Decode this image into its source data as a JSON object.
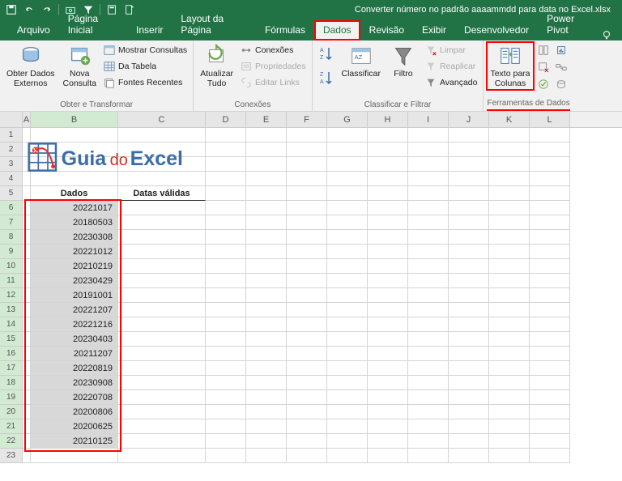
{
  "titlebar": {
    "filename": "Converter número no padrão aaaammdd para data no Excel.xlsx"
  },
  "tabs": {
    "file": "Arquivo",
    "home": "Página Inicial",
    "insert": "Inserir",
    "pagelayout": "Layout da Página",
    "formulas": "Fórmulas",
    "data": "Dados",
    "review": "Revisão",
    "view": "Exibir",
    "developer": "Desenvolvedor",
    "powerpivot": "Power Pivot"
  },
  "ribbon": {
    "get_transform": {
      "label": "Obter e Transformar",
      "external": "Obter Dados\nExternos",
      "newquery": "Nova\nConsulta",
      "show": "Mostrar Consultas",
      "table": "Da Tabela",
      "recent": "Fontes Recentes"
    },
    "connections": {
      "label": "Conexões",
      "refresh": "Atualizar\nTudo",
      "conn": "Conexões",
      "prop": "Propriedades",
      "links": "Editar Links"
    },
    "sortfilter": {
      "label": "Classificar e Filtrar",
      "sort": "Classificar",
      "filter": "Filtro",
      "clear": "Limpar",
      "reapply": "Reaplicar",
      "advanced": "Avançado"
    },
    "datatools": {
      "label": "Ferramentas de Dados",
      "texttocolumns": "Texto para\nColunas"
    }
  },
  "sheet": {
    "cols": [
      "A",
      "B",
      "C",
      "D",
      "E",
      "F",
      "G",
      "H",
      "I",
      "J",
      "K",
      "L"
    ],
    "h1": "Dados",
    "h2": "Datas válidas",
    "rows": [
      "20221017",
      "20180503",
      "20230308",
      "20221012",
      "20210219",
      "20230429",
      "20191001",
      "20221207",
      "20221216",
      "20230403",
      "20211207",
      "20220819",
      "20230908",
      "20220708",
      "20200806",
      "20200625",
      "20210125"
    ]
  },
  "logo": {
    "t1": "Guia",
    "t2": "do",
    "t3": "Excel"
  }
}
